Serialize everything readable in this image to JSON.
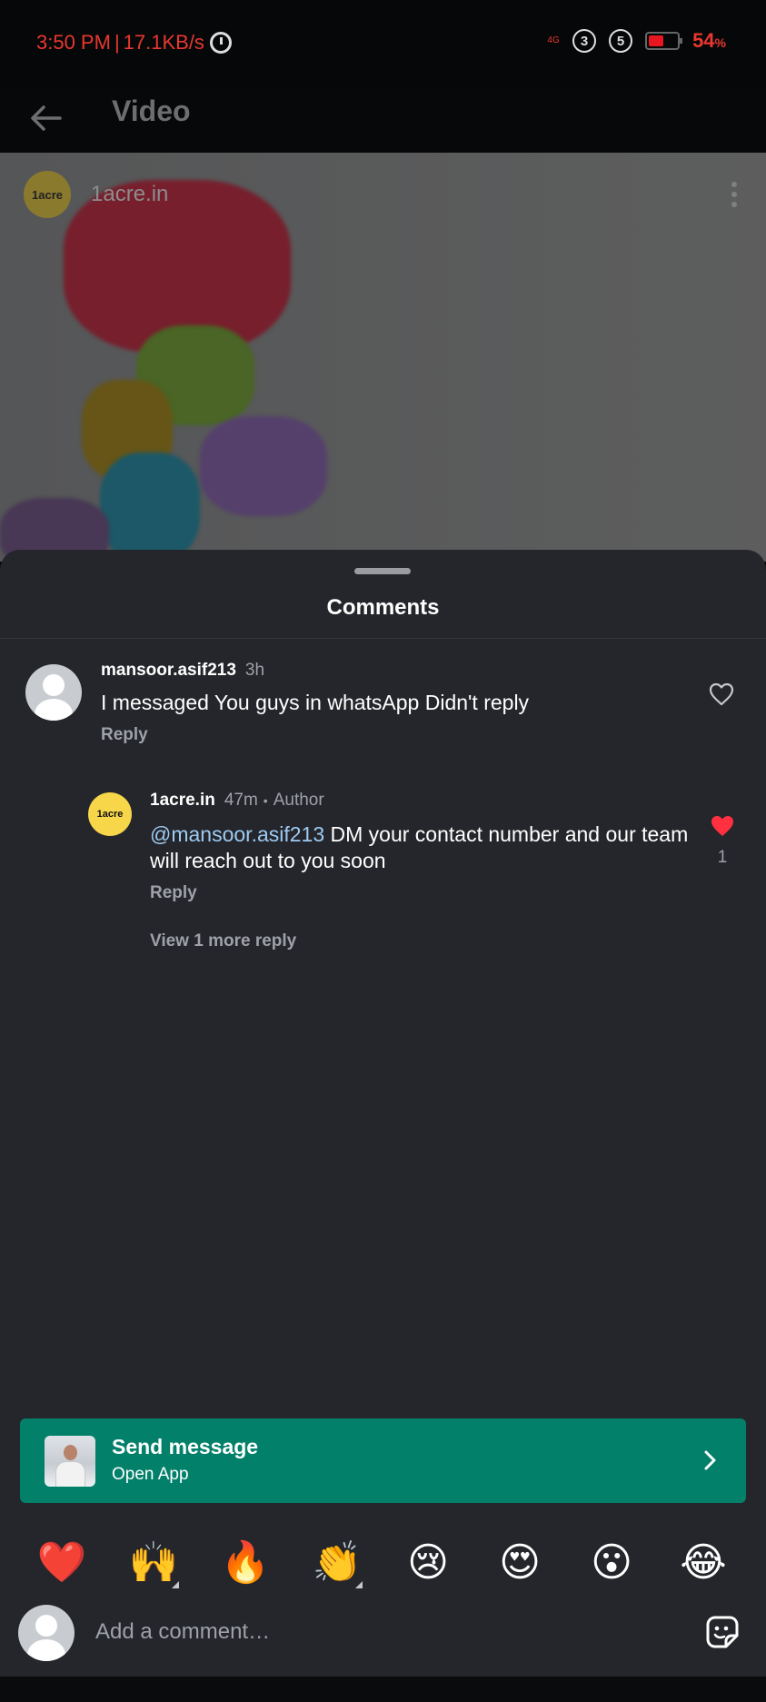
{
  "status_bar": {
    "time": "3:50 PM",
    "separator": "|",
    "speed": "17.1KB/s",
    "network": "4G",
    "sim_badge_1": "3",
    "sim_badge_2": "5",
    "battery_percent": "54",
    "battery_unit": "%",
    "battery_level": 0.54
  },
  "header": {
    "title": "Video",
    "back_icon": "arrow-left-icon"
  },
  "video": {
    "channel_avatar_text": "1acre",
    "channel_name": "1acre.in",
    "more_icon": "more-vertical-icon"
  },
  "comments_sheet": {
    "title": "Comments",
    "comments": [
      {
        "username": "mansoor.asif213",
        "time": "3h",
        "text": "I messaged You guys in whatsApp Didn't reply",
        "reply_label": "Reply",
        "liked": false
      }
    ],
    "reply": {
      "avatar_text": "1acre",
      "username": "1acre.in",
      "time": "47m",
      "dot": "•",
      "author_tag": "Author",
      "mention": "@mansoor.asif213",
      "text": " DM your contact number and our team will reach out to you soon",
      "reply_label": "Reply",
      "liked": true,
      "like_count": "1"
    },
    "view_more_label": "View 1 more reply"
  },
  "send_message": {
    "title": "Send message",
    "subtitle": "Open App"
  },
  "emojis": [
    "❤️",
    "🙌",
    "🔥",
    "👏",
    "😢",
    "😍",
    "😮",
    "😂"
  ],
  "input": {
    "placeholder": "Add a comment…"
  },
  "colors": {
    "accent_green": "#03806a",
    "like_red": "#ff3040",
    "mention_blue": "#9ecbf2",
    "sheet_bg": "#24262b"
  }
}
